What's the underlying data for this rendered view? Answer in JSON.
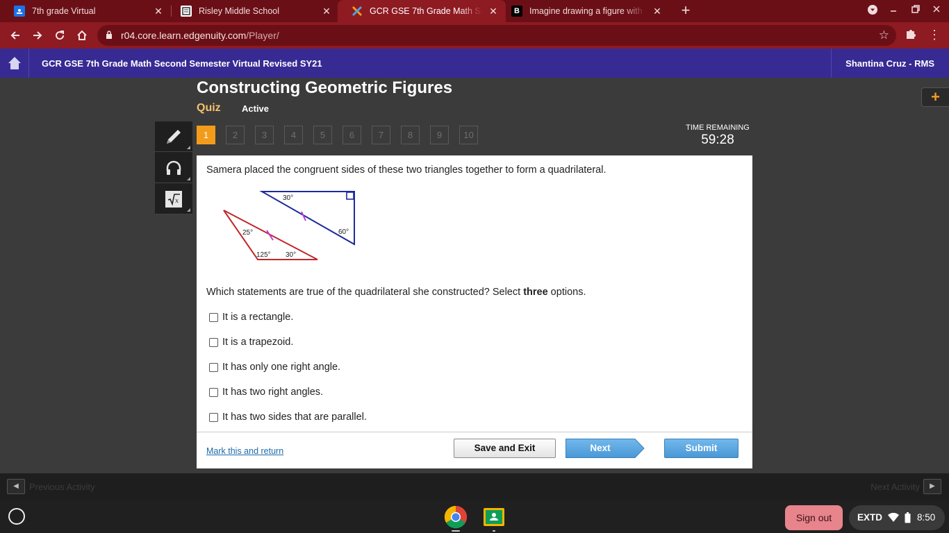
{
  "browser": {
    "tabs": [
      {
        "title": "7th grade Virtual",
        "favicon": "google-classroom-icon"
      },
      {
        "title": "Risley Middle School",
        "favicon": "page-icon"
      },
      {
        "title": "GCR GSE 7th Grade Math Second",
        "favicon": "edgenuity-icon"
      },
      {
        "title": "Imagine drawing a figure with th",
        "favicon": "brainly-icon"
      }
    ],
    "url_host": "r04.core.learn.edgenuity.com",
    "url_path": "/Player/"
  },
  "header": {
    "course_title": "GCR GSE 7th Grade Math Second Semester Virtual Revised SY21",
    "user_name": "Shantina Cruz - RMS"
  },
  "lesson": {
    "title": "Constructing Geometric Figures",
    "type": "Quiz",
    "status": "Active"
  },
  "question_nav": {
    "current": 1,
    "numbers": [
      "1",
      "2",
      "3",
      "4",
      "5",
      "6",
      "7",
      "8",
      "9",
      "10"
    ]
  },
  "timer": {
    "label": "TIME REMAINING",
    "value": "59:28"
  },
  "question": {
    "prompt": "Samera placed the congruent sides of these two triangles together to form a quadrilateral.",
    "ask_before": "Which statements are true of the quadrilateral she constructed? Select ",
    "ask_bold": "three",
    "ask_after": " options.",
    "figure": {
      "red_triangle_angles": [
        "25°",
        "125°",
        "30°"
      ],
      "blue_triangle_angles": [
        "30°",
        "60°"
      ],
      "red_color": "#c0282c",
      "blue_color": "#1d2a9c",
      "tick_color": "#c23bd0"
    },
    "options": [
      {
        "label": "It is a rectangle.",
        "checked": false
      },
      {
        "label": "It is a trapezoid.",
        "checked": false
      },
      {
        "label": "It has only one right angle.",
        "checked": false
      },
      {
        "label": "It has two right angles.",
        "checked": false
      },
      {
        "label": "It has two sides that are parallel.",
        "checked": false
      }
    ]
  },
  "footer": {
    "mark_link": "Mark this and return",
    "save_exit": "Save and Exit",
    "next": "Next",
    "submit": "Submit"
  },
  "activity_nav": {
    "previous": "Previous Activity",
    "next": "Next Activity"
  },
  "shelf": {
    "sign_out": "Sign out",
    "ime": "EXTD",
    "clock": "8:50"
  },
  "colors": {
    "header_bg": "#372a93",
    "accent_orange": "#f39c1b",
    "browser_frame": "#8e1a22"
  }
}
